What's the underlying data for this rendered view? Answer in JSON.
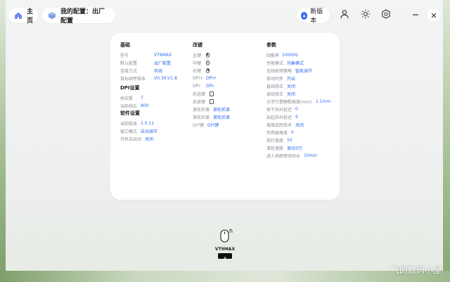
{
  "header": {
    "home_label": "主页",
    "profile_label": "我的配置：出厂配置",
    "update_label": "新版本"
  },
  "basic": {
    "title": "基础",
    "rows": [
      {
        "label": "型号",
        "value": "VT9MAX"
      },
      {
        "label": "默认配置",
        "value": "出厂配置"
      },
      {
        "label": "连接方式",
        "value": "有线"
      },
      {
        "label": "鼠标固件版本",
        "value": "V0.30-V1.8"
      }
    ]
  },
  "dpi": {
    "title": "DPI设置",
    "rows": [
      {
        "label": "档位数",
        "value": "7"
      },
      {
        "label": "当前档位",
        "value": "800"
      }
    ]
  },
  "software": {
    "title": "软件设置",
    "rows": [
      {
        "label": "当前版本",
        "value": "1.0.11"
      },
      {
        "label": "窗口模式",
        "value": "自动调节"
      },
      {
        "label": "开机自启动",
        "value": "关闭"
      }
    ]
  },
  "remap": {
    "title": "改键",
    "rows": [
      {
        "label": "左键",
        "value": "",
        "icon": "mouse-left-icon"
      },
      {
        "label": "中键",
        "value": "",
        "icon": "mouse-middle-icon"
      },
      {
        "label": "右键",
        "value": "",
        "icon": "mouse-right-icon"
      },
      {
        "label": "DPI+",
        "value": "DPI+"
      },
      {
        "label": "DPI-",
        "value": "DPI-"
      },
      {
        "label": "前进键",
        "value": "",
        "icon": "forward-key-icon"
      },
      {
        "label": "后退键",
        "value": "",
        "icon": "back-key-icon"
      },
      {
        "label": "滚轮前滚",
        "value": "滚轮前滚"
      },
      {
        "label": "滚轮后滚",
        "value": "滚轮后滚"
      },
      {
        "label": "DIY键",
        "value": "DIY键"
      }
    ]
  },
  "params": {
    "title": "参数",
    "rows": [
      {
        "label": "回报率",
        "value": "1000Hz"
      },
      {
        "label": "性能模式",
        "value": "均衡模式"
      },
      {
        "label": "无线射频策略",
        "value": "智能调节"
      },
      {
        "label": "移动同步",
        "value": "开启"
      },
      {
        "label": "直线修正",
        "value": "关闭"
      },
      {
        "label": "波纹修正",
        "value": "关闭"
      },
      {
        "label": "光学引擎静默高度(mm)",
        "value": "1.1mm"
      },
      {
        "label": "按下去抖延迟",
        "value": "0"
      },
      {
        "label": "抬起去抖延迟",
        "value": "6"
      },
      {
        "label": "玻璃追踪技术",
        "value": "关闭"
      },
      {
        "label": "传感器角度",
        "value": "0"
      },
      {
        "label": "指针速度",
        "value": "10"
      },
      {
        "label": "滚轮速度",
        "value": "滚动3行"
      },
      {
        "label": "进入休眠等待时长",
        "value": "10min"
      }
    ]
  },
  "device": {
    "name": "VT9MAX",
    "battery_level": 0.75
  },
  "watermark": "飞的数码小屋",
  "colors": {
    "accent": "#2f6bf0",
    "label": "#8a8f96"
  }
}
